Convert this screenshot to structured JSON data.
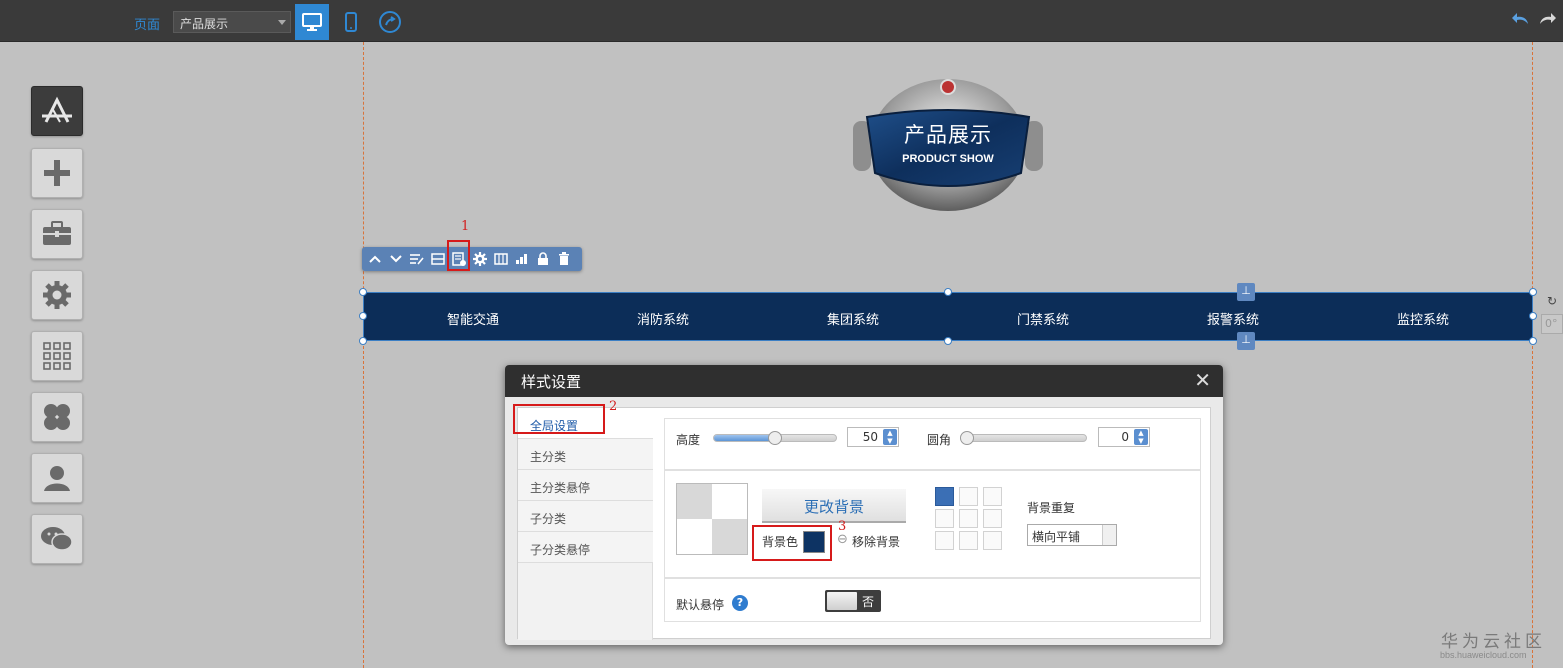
{
  "topbar": {
    "page_label": "页面",
    "page_select_value": "产品展示",
    "accent_color": "#2f88d3"
  },
  "tools": [
    "app-icon",
    "add-icon",
    "toolbox-icon",
    "gear-icon",
    "grid-icon",
    "clover-icon",
    "user-icon",
    "wechat-icon"
  ],
  "logo": {
    "title_cn": "产品展示",
    "title_en": "PRODUCT SHOW"
  },
  "markers": {
    "m1": "1",
    "m2": "2",
    "m3": "3"
  },
  "navbar": {
    "background": "#0c2d58",
    "items": [
      "智能交通",
      "消防系统",
      "集团系统",
      "门禁系统",
      "报警系统",
      "监控系统"
    ]
  },
  "rotation_value": "0°",
  "dialog": {
    "title": "样式设置",
    "close": "✕",
    "tabs": [
      "全局设置",
      "主分类",
      "主分类悬停",
      "子分类",
      "子分类悬停"
    ],
    "height_label": "高度",
    "height_value": "50",
    "height_fraction": 0.5,
    "radius_label": "圆角",
    "radius_value": "0",
    "change_bg_button": "更改背景",
    "bg_color_label": "背景色",
    "bg_color": "#0d3363",
    "remove_bg_label": "移除背景",
    "bg_repeat_label": "背景重复",
    "bg_repeat_value": "横向平铺",
    "default_hover_label": "默认悬停",
    "default_hover_value": "否"
  },
  "watermark": {
    "cn": "华为云社区",
    "url": "bbs.huaweicloud.com"
  }
}
